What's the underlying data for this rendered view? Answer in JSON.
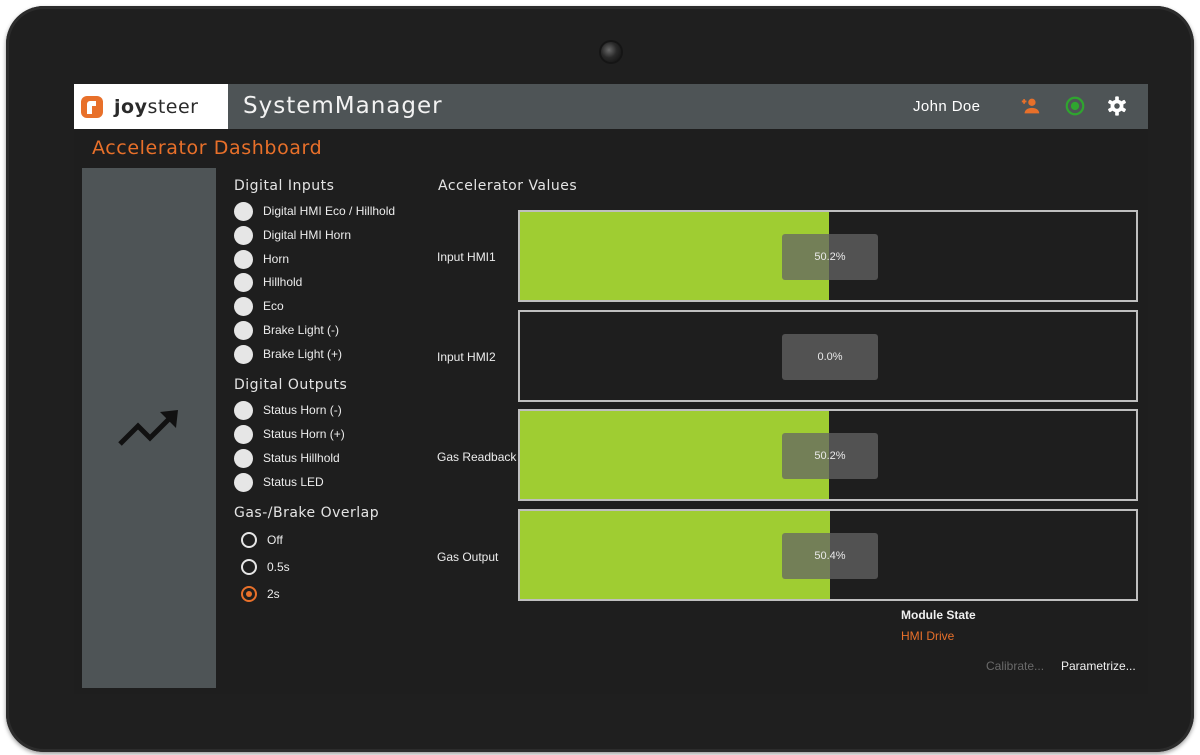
{
  "header": {
    "logo_text_bold": "joy",
    "logo_text_light": "steer",
    "app_title": "SystemManager",
    "user_name": "John Doe",
    "icons": [
      "add-user-icon",
      "power-status-icon",
      "settings-gear-icon"
    ]
  },
  "page_title": "Accelerator Dashboard",
  "digital_inputs": {
    "heading": "Digital Inputs",
    "items": [
      "Digital HMI Eco / Hillhold",
      "Digital HMI Horn",
      "Horn",
      "Hillhold",
      "Eco",
      "Brake Light (-)",
      "Brake Light (+)"
    ]
  },
  "digital_outputs": {
    "heading": "Digital Outputs",
    "items": [
      "Status Horn (-)",
      "Status Horn (+)",
      "Status Hillhold",
      "Status LED"
    ]
  },
  "overlap": {
    "heading": "Gas-/Brake Overlap",
    "options": [
      "Off",
      "0.5s",
      "2s"
    ],
    "selected": "2s"
  },
  "accelerator": {
    "heading": "Accelerator Values",
    "gauges": [
      {
        "label": "Input HMI1",
        "value": 0.502,
        "text": "50.2%"
      },
      {
        "label": "Input HMI2",
        "value": 0.0,
        "text": "0.0%"
      },
      {
        "label": "Gas Readback",
        "value": 0.502,
        "text": "50.2%"
      },
      {
        "label": "Gas Output",
        "value": 0.504,
        "text": "50.4%"
      }
    ]
  },
  "module_state": {
    "label": "Module State",
    "value": "HMI Drive"
  },
  "buttons": {
    "calibrate": "Calibrate...",
    "parametrize": "Parametrize..."
  },
  "colors": {
    "accent": "#e8702a",
    "bar_fill": "#9fcd32",
    "header_bg": "#4e5456",
    "status_green": "#2fa52f"
  }
}
